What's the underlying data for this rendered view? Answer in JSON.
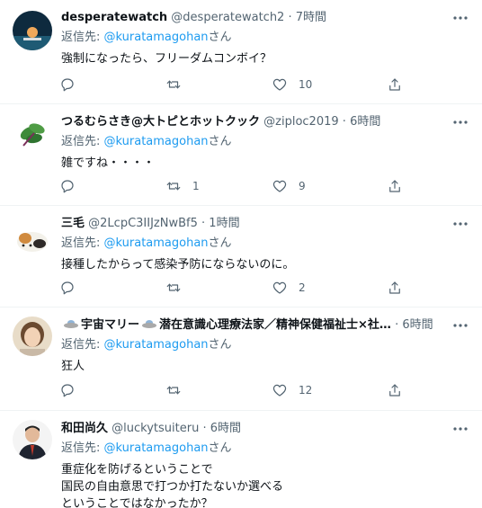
{
  "tweets": [
    {
      "name": "desperatewatch",
      "handle": "@desperatewatch2",
      "dot": "·",
      "time": "7時間",
      "reply_prefix": "返信先: ",
      "reply_to": "@kuratamagohan",
      "reply_suffix": "さん",
      "text": "強制になったら、フリーダムコンボイ？",
      "likes": "10",
      "retweets": ""
    },
    {
      "name": "つるむらさき@大トピとホットクック",
      "handle": "@ziploc2019",
      "dot": "·",
      "time": "6時間",
      "reply_prefix": "返信先: ",
      "reply_to": "@kuratamagohan",
      "reply_suffix": "さん",
      "text": "雑ですね・・・・",
      "likes": "9",
      "retweets": "1"
    },
    {
      "name": "三毛",
      "handle": "@2LcpC3IIJzNwBf5",
      "dot": "·",
      "time": "1時間",
      "reply_prefix": "返信先: ",
      "reply_to": "@kuratamagohan",
      "reply_suffix": "さん",
      "text": "接種したからって感染予防にならないのに。",
      "likes": "2",
      "retweets": ""
    },
    {
      "name_part1": "宇宙マリー",
      "name_part2": "潜在意識心理療法家／精神保健福祉士×社…",
      "dot": "·",
      "time": "6時間",
      "reply_prefix": "返信先: ",
      "reply_to": "@kuratamagohan",
      "reply_suffix": "さん",
      "text": "狂人",
      "likes": "12",
      "retweets": ""
    },
    {
      "name": "和田尚久",
      "handle": "@luckytsuiteru",
      "dot": "·",
      "time": "6時間",
      "reply_prefix": "返信先: ",
      "reply_to": "@kuratamagohan",
      "reply_suffix": "さん",
      "text": "重症化を防げるということで\n国民の自由意思で打つか打たないか選べる\nということではなかったか？"
    }
  ],
  "icons": {
    "reply": "reply-icon",
    "retweet": "retweet-icon",
    "like": "heart-icon",
    "share": "share-icon",
    "more": "more-icon"
  },
  "colors": {
    "accent": "#1d9bf0",
    "secondary_text": "#536471",
    "primary_text": "#0f1419",
    "divider": "#eff3f4"
  }
}
